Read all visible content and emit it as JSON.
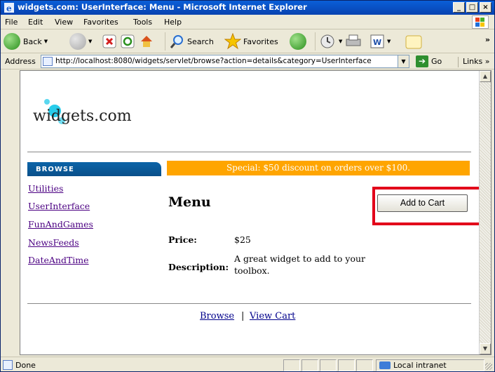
{
  "window": {
    "title": "widgets.com: UserInterface: Menu - Microsoft Internet Explorer",
    "controls": [
      "_",
      "□",
      "×"
    ]
  },
  "menubar": {
    "items": [
      "File",
      "Edit",
      "View",
      "Favorites",
      "Tools",
      "Help"
    ]
  },
  "toolbar": {
    "back_label": "Back",
    "search_label": "Search",
    "favorites_label": "Favorites"
  },
  "addressbar": {
    "label": "Address",
    "url": "http://localhost:8080/widgets/servlet/browse?action=details&category=UserInterface",
    "go_label": "Go",
    "links_label": "Links »"
  },
  "page": {
    "logo_text": "widgets.com",
    "browse_header": "BROWSE",
    "banner": "Special: $50 discount on orders over $100.",
    "categories": [
      "Utilities",
      "UserInterface",
      "FunAndGames",
      "NewsFeeds",
      "DateAndTime"
    ],
    "product": {
      "name": "Menu",
      "add_to_cart": "Add to Cart",
      "price_label": "Price:",
      "price_value": "$25",
      "description_label": "Description:",
      "description_line1": "A great widget to add to your",
      "description_line2": "toolbox."
    },
    "footer": {
      "browse_link": "Browse",
      "separator": "|",
      "view_cart_link": "View Cart"
    }
  },
  "statusbar": {
    "status": "Done",
    "zone": "Local intranet"
  },
  "colors": {
    "banner": "#ffa500",
    "browse_header": "#0b64a8",
    "highlight": "#e2001a",
    "link": "#4b0082"
  }
}
